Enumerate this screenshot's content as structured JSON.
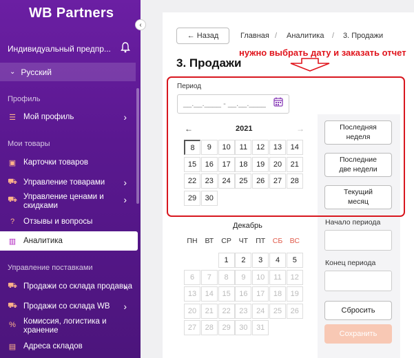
{
  "colors": {
    "sidebar": "#5a1890",
    "annotation": "#e0141c",
    "save_button": "#f8c8b4"
  },
  "sidebar": {
    "logo": "WB Partners",
    "org": "Индивидуальный предпр...",
    "language": "Русский",
    "section_profile": "Профиль",
    "my_profile": "Мой профиль",
    "section_goods": "Мои товары",
    "goods_items": [
      "Карточки товаров",
      "Управление товарами",
      "Управление ценами и",
      "скидками",
      "Отзывы и вопросы",
      "Аналитика"
    ],
    "section_supply": "Управление поставками",
    "supply_items": [
      "Продажи со склада продавца",
      "Продажи со склада WB",
      "Комиссия, логистика и",
      "хранение",
      "Адреса складов"
    ]
  },
  "header": {
    "back": "← Назад",
    "breadcrumbs": [
      "Главная",
      "Аналитика",
      "3. Продажи"
    ],
    "title": "3. Продажи",
    "annotation": "нужно выбрать дату и заказать отчет"
  },
  "period": {
    "label": "Период",
    "placeholder": "__.__.____ - __.__.____"
  },
  "calendar": {
    "year": "2021",
    "prev": "←",
    "next": "→",
    "top_rows": [
      [
        "8",
        "9",
        "10",
        "11",
        "12",
        "13",
        "14"
      ],
      [
        "15",
        "16",
        "17",
        "18",
        "19",
        "20",
        "21"
      ],
      [
        "22",
        "23",
        "24",
        "25",
        "26",
        "27",
        "28"
      ],
      [
        "29",
        "30"
      ]
    ],
    "month": "Декабрь",
    "weekdays": [
      "ПН",
      "ВТ",
      "СР",
      "ЧТ",
      "ПТ",
      "СБ",
      "ВС"
    ],
    "december_rows": [
      [
        "",
        "",
        "",
        "1",
        "2",
        "3",
        "4",
        "5"
      ],
      [
        "6",
        "7",
        "8",
        "9",
        "10",
        "11",
        "12"
      ],
      [
        "13",
        "14",
        "15",
        "16",
        "17",
        "18",
        "19"
      ],
      [
        "20",
        "21",
        "22",
        "23",
        "24",
        "25",
        "26"
      ],
      [
        "27",
        "28",
        "29",
        "30",
        "31"
      ]
    ]
  },
  "right_panel": {
    "last_week": [
      "Последняя",
      "неделя"
    ],
    "last_two_weeks": [
      "Последние",
      "две недели"
    ],
    "current_month": [
      "Текущий",
      "месяц"
    ],
    "start_label": "Начало периода",
    "end_label": "Конец периода",
    "reset": "Сбросить",
    "save": "Сохранить"
  }
}
